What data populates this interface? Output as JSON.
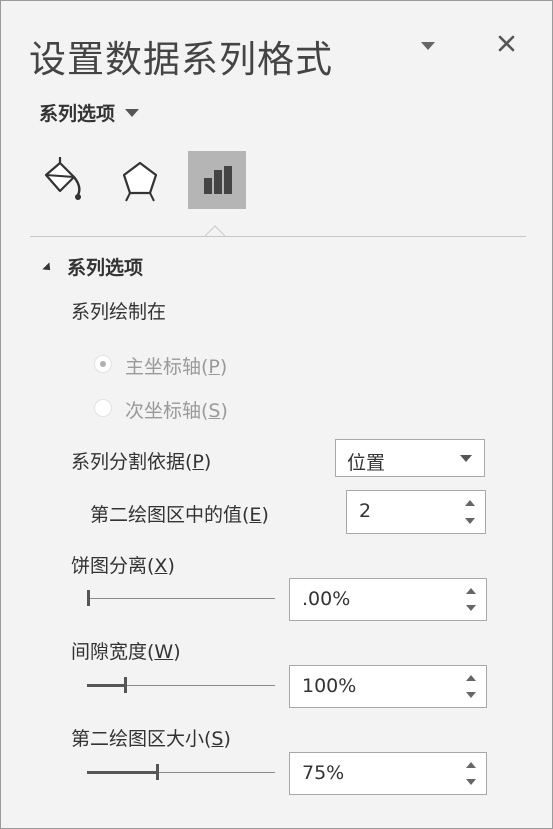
{
  "pane": {
    "title": "设置数据系列格式",
    "options_dropdown": "系列选项"
  },
  "tabs": [
    {
      "name": "fill-line",
      "icon": "paint-bucket-icon"
    },
    {
      "name": "effects",
      "icon": "pentagon-icon"
    },
    {
      "name": "series-options",
      "icon": "bar-chart-icon",
      "active": true
    }
  ],
  "section": {
    "title": "系列选项",
    "plot_on_label": "系列绘制在",
    "primary_axis": {
      "text": "主坐标轴(",
      "key": "P",
      "suffix": ")",
      "selected": true,
      "disabled": true
    },
    "secondary_axis": {
      "text": "次坐标轴(",
      "key": "S",
      "suffix": ")",
      "selected": false,
      "disabled": true
    },
    "split_by": {
      "text": "系列分割依据(",
      "key": "P",
      "suffix": ")",
      "value": "位置"
    },
    "second_plot_values": {
      "text": "第二绘图区中的值(",
      "key": "E",
      "suffix": ")",
      "value": "2"
    },
    "pie_explosion": {
      "text": "饼图分离(",
      "key": "X",
      "suffix": ")",
      "value": ".00%",
      "level": 0.0
    },
    "gap_width": {
      "text": "间隙宽度(",
      "key": "W",
      "suffix": ")",
      "value": "100%",
      "level": 0.2
    },
    "second_plot_size": {
      "text": "第二绘图区大小(",
      "key": "S",
      "suffix": ")",
      "value": "75%",
      "level": 0.37
    }
  }
}
